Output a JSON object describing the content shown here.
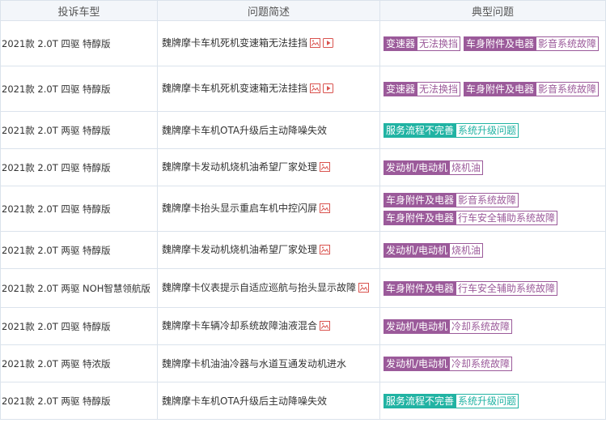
{
  "headers": [
    "投诉车型",
    "问题简述",
    "典型问题"
  ],
  "colors": {
    "purple": "#9b5a9a",
    "green": "#21b3a3",
    "border": "#dbe3ec",
    "header_bg": "#f3f6fa"
  },
  "rows": [
    {
      "model": "2021款 2.0T 四驱 特醇版",
      "title": "魏牌摩卡车机死机变速箱无法挂挡",
      "has_image": true,
      "has_video": true,
      "color": "purple",
      "tag_groups": [
        [
          "变速器",
          "无法换挡"
        ],
        [
          "车身附件及电器",
          "影音系统故障"
        ]
      ]
    },
    {
      "model": "2021款 2.0T 四驱 特醇版",
      "title": "魏牌摩卡车机死机变速箱无法挂挡",
      "has_image": true,
      "has_video": true,
      "color": "purple",
      "tag_groups": [
        [
          "变速器",
          "无法换挡"
        ],
        [
          "车身附件及电器",
          "影音系统故障"
        ]
      ]
    },
    {
      "model": "2021款 2.0T 两驱 特醇版",
      "title": "魏牌摩卡车机OTA升级后主动降噪失效",
      "has_image": false,
      "has_video": false,
      "color": "green",
      "tag_groups": [
        [
          "服务流程不完善",
          "系统升级问题"
        ]
      ]
    },
    {
      "model": "2021款 2.0T 四驱 特醇版",
      "title": "魏牌摩卡发动机烧机油希望厂家处理",
      "has_image": true,
      "has_video": false,
      "color": "purple",
      "tag_groups": [
        [
          "发动机/电动机",
          "烧机油"
        ]
      ]
    },
    {
      "model": "2021款 2.0T 四驱 特醇版",
      "title": "魏牌摩卡抬头显示重启车机中控闪屏",
      "has_image": true,
      "has_video": false,
      "color": "purple",
      "tag_groups": [
        [
          "车身附件及电器",
          "影音系统故障"
        ],
        [
          "车身附件及电器",
          "行车安全辅助系统故障"
        ]
      ]
    },
    {
      "model": "2021款 2.0T 两驱 特醇版",
      "title": "魏牌摩卡发动机烧机油希望厂家处理",
      "has_image": true,
      "has_video": false,
      "color": "purple",
      "tag_groups": [
        [
          "发动机/电动机",
          "烧机油"
        ]
      ]
    },
    {
      "model": "2021款 2.0T 两驱 NOH智慧领航版",
      "title": "魏牌摩卡仪表提示自适应巡航与抬头显示故障",
      "has_image": true,
      "has_video": false,
      "color": "purple",
      "tag_groups": [
        [
          "车身附件及电器",
          "行车安全辅助系统故障"
        ]
      ]
    },
    {
      "model": "2021款 2.0T 四驱 特醇版",
      "title": "魏牌摩卡车辆冷却系统故障油液混合",
      "has_image": true,
      "has_video": false,
      "color": "purple",
      "tag_groups": [
        [
          "发动机/电动机",
          "冷却系统故障"
        ]
      ]
    },
    {
      "model": "2021款 2.0T 两驱 特浓版",
      "title": "魏牌摩卡机油油冷器与水道互通发动机进水",
      "has_image": false,
      "has_video": false,
      "color": "purple",
      "tag_groups": [
        [
          "发动机/电动机",
          "冷却系统故障"
        ]
      ]
    },
    {
      "model": "2021款 2.0T 两驱 特醇版",
      "title": "魏牌摩卡车机OTA升级后主动降噪失效",
      "has_image": false,
      "has_video": false,
      "color": "green",
      "tag_groups": [
        [
          "服务流程不完善",
          "系统升级问题"
        ]
      ]
    }
  ]
}
